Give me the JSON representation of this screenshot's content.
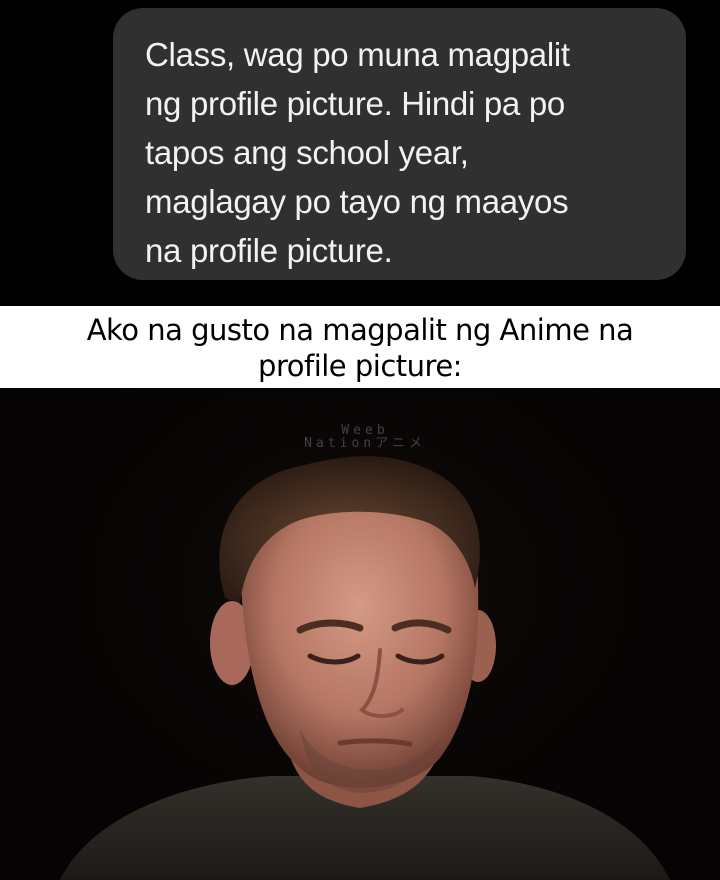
{
  "chat": {
    "message": "Class, wag po muna magpalit\nng profile picture. Hindi pa po\ntapos ang school year,\nmaglagay po tayo ng maayos\nna profile picture."
  },
  "caption": {
    "text": "Ako na gusto na magpalit ng Anime na\nprofile picture:"
  },
  "photo": {
    "watermark_line1": "Weeb",
    "watermark_line2": "Nationアニメ"
  }
}
